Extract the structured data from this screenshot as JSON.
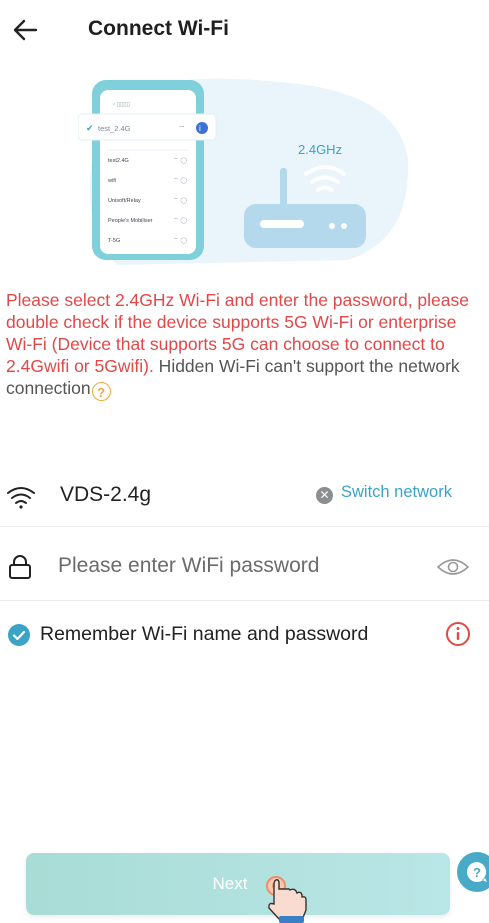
{
  "header": {
    "title": "Connect Wi-Fi"
  },
  "illustration": {
    "band_label": "2.4GHz",
    "phone_selected_network": "test_2.4G",
    "phone_list": [
      "test2.4G",
      "wifi",
      "Unisoft/Relay",
      "People's Mobiliser",
      "T-5G"
    ]
  },
  "notice": {
    "warning": "Please select 2.4GHz Wi-Fi and enter the password, please double check if the device supports 5G Wi-Fi or enterprise Wi-Fi (Device that supports 5G can choose to connect to 2.4Gwifi or 5Gwifi).",
    "info": " Hidden Wi-Fi can't support the network connection"
  },
  "network": {
    "ssid": "VDS-2.4g",
    "switch_label": "Switch network"
  },
  "password": {
    "placeholder": "Please enter WiFi password",
    "value": ""
  },
  "remember": {
    "label": "Remember Wi-Fi name and password",
    "checked": true
  },
  "next_button": {
    "label": "Next"
  },
  "colors": {
    "accent": "#3aa3c6",
    "warning": "#e24848",
    "button_bg": "#b0e0dc",
    "help": "#f0a93b",
    "check": "#3aa3c6"
  }
}
